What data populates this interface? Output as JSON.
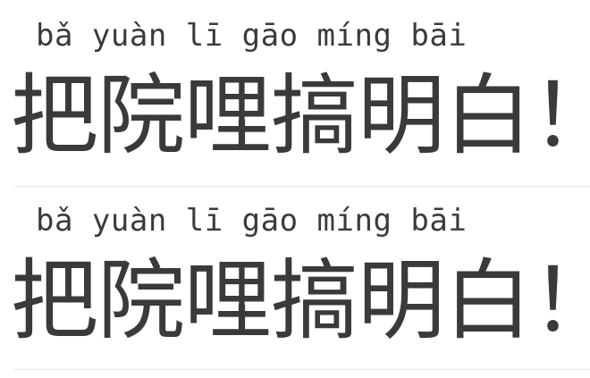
{
  "entries": [
    {
      "pinyin": "bǎ yuàn lī gāo míng bāi",
      "hanzi": "把院哩搞明白！"
    },
    {
      "pinyin": "bǎ yuàn lī gāo míng bāi",
      "hanzi": "把院哩搞明白！"
    }
  ]
}
